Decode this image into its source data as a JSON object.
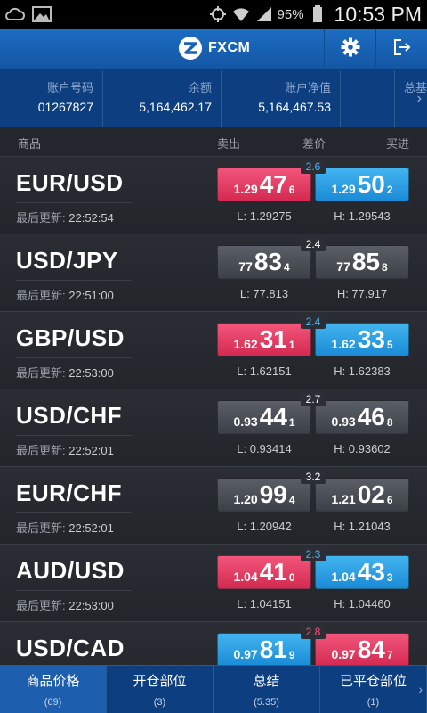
{
  "status_bar": {
    "battery_pct": "95%",
    "time": "10:53 PM"
  },
  "app_bar": {
    "title": "FXCM"
  },
  "account": {
    "cells": [
      {
        "label": "账户号码",
        "value": "01267827"
      },
      {
        "label": "余额",
        "value": "5,164,462.17"
      },
      {
        "label": "账户净值",
        "value": "5,164,467.53"
      }
    ],
    "more_label": "总基"
  },
  "columns": {
    "symbol": "商品",
    "sell": "卖出",
    "spread": "差价",
    "buy": "买进"
  },
  "last_update_label": "最后更新:",
  "rows": [
    {
      "symbol": "EUR/USD",
      "time": "22:52:54",
      "spread": "2.6",
      "spread_color": "blue",
      "sell": {
        "pre": "1.29",
        "big": "47",
        "sup": "6",
        "color": "red"
      },
      "buy": {
        "pre": "1.29",
        "big": "50",
        "sup": "2",
        "color": "blue"
      },
      "low": "L: 1.29275",
      "high": "H: 1.29543"
    },
    {
      "symbol": "USD/JPY",
      "time": "22:51:00",
      "spread": "2.4",
      "spread_color": "white",
      "sell": {
        "pre": "77",
        "big": "83",
        "sup": "4",
        "color": "gray"
      },
      "buy": {
        "pre": "77",
        "big": "85",
        "sup": "8",
        "color": "gray"
      },
      "low": "L: 77.813",
      "high": "H: 77.917"
    },
    {
      "symbol": "GBP/USD",
      "time": "22:53:00",
      "spread": "2.4",
      "spread_color": "blue",
      "sell": {
        "pre": "1.62",
        "big": "31",
        "sup": "1",
        "color": "red"
      },
      "buy": {
        "pre": "1.62",
        "big": "33",
        "sup": "5",
        "color": "blue"
      },
      "low": "L: 1.62151",
      "high": "H: 1.62383"
    },
    {
      "symbol": "USD/CHF",
      "time": "22:52:01",
      "spread": "2.7",
      "spread_color": "white",
      "sell": {
        "pre": "0.93",
        "big": "44",
        "sup": "1",
        "color": "gray"
      },
      "buy": {
        "pre": "0.93",
        "big": "46",
        "sup": "8",
        "color": "gray"
      },
      "low": "L: 0.93414",
      "high": "H: 0.93602"
    },
    {
      "symbol": "EUR/CHF",
      "time": "22:52:01",
      "spread": "3.2",
      "spread_color": "white",
      "sell": {
        "pre": "1.20",
        "big": "99",
        "sup": "4",
        "color": "gray"
      },
      "buy": {
        "pre": "1.21",
        "big": "02",
        "sup": "6",
        "color": "gray"
      },
      "low": "L: 1.20942",
      "high": "H: 1.21043"
    },
    {
      "symbol": "AUD/USD",
      "time": "22:53:00",
      "spread": "2.3",
      "spread_color": "blue",
      "sell": {
        "pre": "1.04",
        "big": "41",
        "sup": "0",
        "color": "red"
      },
      "buy": {
        "pre": "1.04",
        "big": "43",
        "sup": "3",
        "color": "blue"
      },
      "low": "L: 1.04151",
      "high": "H: 1.04460"
    },
    {
      "symbol": "USD/CAD",
      "time": "",
      "spread": "2.8",
      "spread_color": "red",
      "sell": {
        "pre": "0.97",
        "big": "81",
        "sup": "9",
        "color": "blue"
      },
      "buy": {
        "pre": "0.97",
        "big": "84",
        "sup": "7",
        "color": "red"
      },
      "low": "",
      "high": ""
    }
  ],
  "tabs": [
    {
      "name": "商品价格",
      "count": "(69)",
      "active": true
    },
    {
      "name": "开仓部位",
      "count": "(3)",
      "active": false
    },
    {
      "name": "总结",
      "count": "(5.35)",
      "active": false
    },
    {
      "name": "已平仓部位",
      "count": "(1)",
      "active": false
    }
  ]
}
